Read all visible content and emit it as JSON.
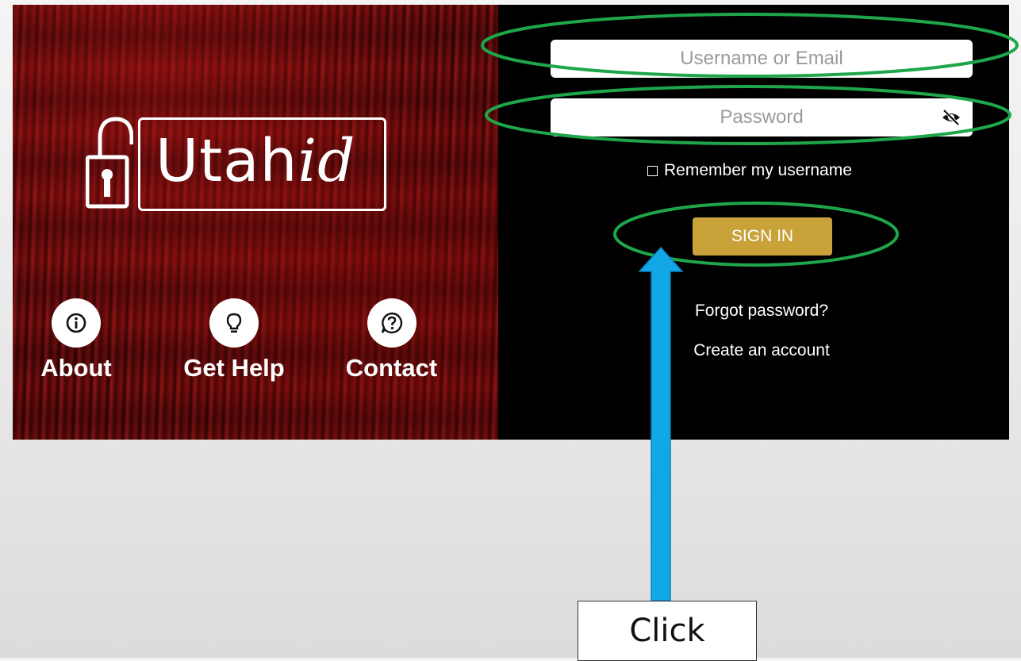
{
  "logo": {
    "text_main": "Utah",
    "text_italic": "id"
  },
  "nav": [
    {
      "label": "About",
      "icon": "info-icon"
    },
    {
      "label": "Get Help",
      "icon": "lightbulb-icon"
    },
    {
      "label": "Contact",
      "icon": "question-bubble-icon"
    }
  ],
  "form": {
    "username_placeholder": "Username or Email",
    "password_placeholder": "Password",
    "password_toggle_icon": "eye-slash-icon",
    "remember_label": "Remember my username",
    "signin_label": "SIGN IN",
    "forgot_label": "Forgot password?",
    "create_label": "Create an account"
  },
  "annotation": {
    "callout_text": "Click"
  },
  "colors": {
    "signin_button": "#c9a23a",
    "highlight_ellipse": "#1fa64a",
    "arrow": "#12a8e8",
    "form_background": "#000000"
  }
}
